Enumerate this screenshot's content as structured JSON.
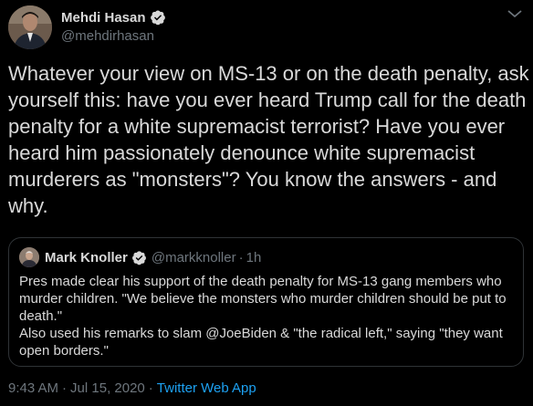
{
  "author": {
    "name": "Mehdi Hasan",
    "handle": "@mehdirhasan"
  },
  "tweet": {
    "text": "Whatever your view on MS-13 or on the death penalty, ask yourself this: have you ever heard Trump call for the death penalty for a white supremacist terrorist? Have you ever heard him passionately denounce white supremacist murderers as \"monsters\"? You know the answers - and why."
  },
  "quoted_tweet": {
    "name": "Mark Knoller",
    "handle": "@markknoller",
    "separator": "·",
    "time": "1h",
    "text": "Pres made clear his support of the death penalty for MS-13 gang members who murder children. \"We believe the monsters who murder children should be put to death.\"\nAlso used his remarks to slam @JoeBiden & \"the radical left,\" saying \"they want open borders.\""
  },
  "meta": {
    "time": "9:43 AM",
    "date": "Jul 15, 2020",
    "separator": "·",
    "app": "Twitter Web App"
  },
  "icons": {
    "verified": "verified-badge-icon",
    "more": "chevron-down-icon"
  },
  "colors": {
    "background": "#000000",
    "text": "#d9d9d9",
    "secondary": "#6e767d",
    "accent": "#1da1f2",
    "border": "#2f3336"
  }
}
